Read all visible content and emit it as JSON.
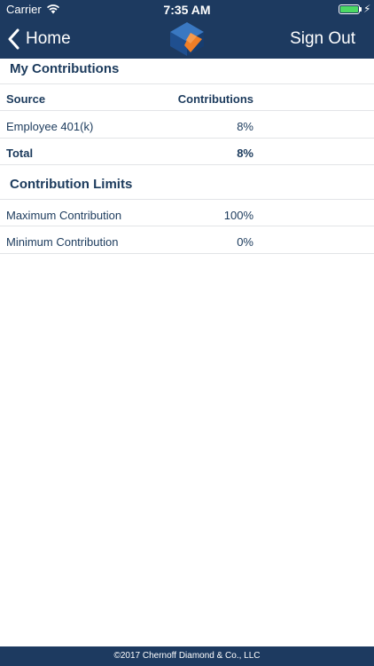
{
  "status_bar": {
    "carrier": "Carrier",
    "time": "7:35 AM",
    "battery_level": 1.0
  },
  "nav": {
    "back_label": "Home",
    "signout_label": "Sign Out",
    "logo_icon": "diamond-cube-logo"
  },
  "contributions": {
    "title": "My Contributions",
    "headers": {
      "source": "Source",
      "contributions": "Contributions"
    },
    "rows": [
      {
        "source": "Employee 401(k)",
        "value": "8%"
      }
    ],
    "total": {
      "label": "Total",
      "value": "8%"
    }
  },
  "limits": {
    "title": "Contribution Limits",
    "rows": [
      {
        "label": "Maximum Contribution",
        "value": "100%"
      },
      {
        "label": "Minimum Contribution",
        "value": "0%"
      }
    ]
  },
  "footer": {
    "text": "©2017 Chernoff Diamond & Co., LLC"
  },
  "colors": {
    "nav_background": "#1d3a60",
    "text": "#1b3a5c",
    "logo_blue": "#2a63a8",
    "logo_orange": "#f07e26",
    "battery_green": "#4cd964"
  }
}
